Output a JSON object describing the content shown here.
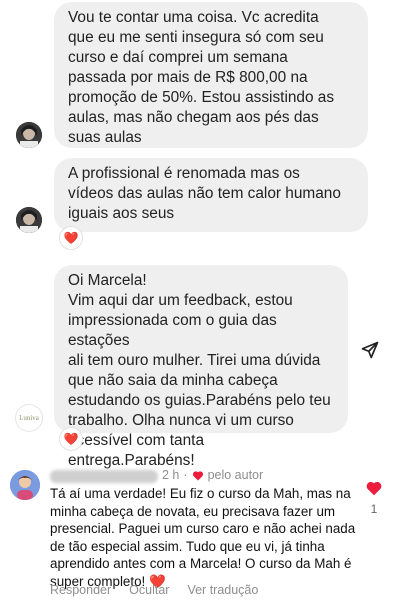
{
  "messages": [
    {
      "text": "Vou te contar uma coisa. Vc acredita\nque eu me senti insegura só com seu\ncurso e daí comprei um semana\npassada por mais de  R$ 800,00 na\npromoção de 50%. Estou assistindo as\naulas, mas não chegam aos pés das\nsuas aulas",
      "reaction": ""
    },
    {
      "text": "A profissional é renomada mas os\nvídeos das aulas não tem calor humano\niguais aos seus",
      "reaction": "❤️"
    },
    {
      "text": "Oi Marcela!\nVim aqui dar um feedback, estou\nimpressionada com o guia das estações\nali tem ouro mulher. Tirei uma dúvida\nque não saia da minha cabeça\nestudando os guias.Parabéns pelo teu\ntrabalho. Olha nunca vi um curso\nacessível com tanta entrega.Parabéns!",
      "reaction": "❤️"
    }
  ],
  "sender_avatar_logo": "Luniva",
  "comment": {
    "time": "2 h",
    "separator": "·",
    "author_badge": "pelo autor",
    "text": "Tá aí uma verdade! Eu fiz o curso da Mah, mas na minha cabeça de novata, eu precisava fazer um presencial. Paguei um curso caro e não achei nada de tão especial assim. Tudo que eu vi, já tinha aprendido antes com a Marcela! O curso da Mah é super completo! ❤️",
    "like_count": "1",
    "actions": {
      "reply": "Responder",
      "hide": "Ocultar",
      "translate": "Ver tradução"
    }
  },
  "colors": {
    "heart": "#ed1c3c",
    "bubble": "#efefef",
    "meta": "#8e8e8e"
  },
  "icons": [
    "heart-icon",
    "send-icon",
    "avatar"
  ]
}
